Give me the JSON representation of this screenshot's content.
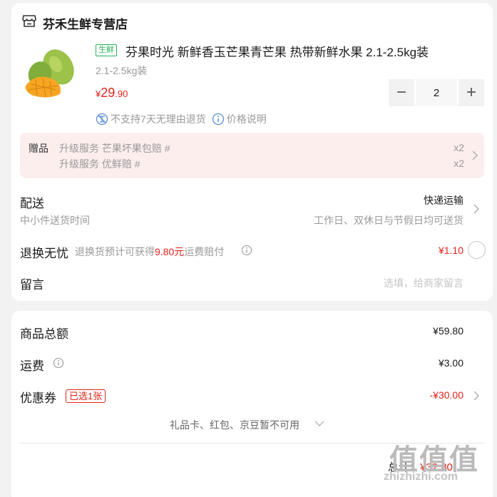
{
  "store": {
    "name": "芬禾生鲜专营店",
    "icon": "store-icon"
  },
  "product": {
    "tag": "生鲜",
    "title": "芬果时光 新鲜香玉芒果青芒果 热带新鲜水果 2.1-2.5kg装",
    "spec": "2.1-2.5kg装",
    "price_symbol": "¥",
    "price_int": "29",
    "price_dec": ".90",
    "quantity": "2",
    "minus": "−",
    "plus": "+",
    "no_return": "不支持7天无理由退货",
    "price_note": "价格说明"
  },
  "gift": {
    "label": "赠品",
    "items": [
      {
        "name": "升级服务 芒果坏果包赔 #",
        "qty": "x2"
      },
      {
        "name": "升级服务 优鲜赔 #",
        "qty": "x2"
      }
    ]
  },
  "delivery": {
    "label": "配送",
    "method": "快递运输",
    "sub_left": "中小件送货时间",
    "sub_right": "工作日、双休日与节假日均可送货"
  },
  "return_worry": {
    "label": "退换无忧",
    "desc_prefix": "退换货预计可获得",
    "desc_amount": "9.80元",
    "desc_suffix": "运费赔付",
    "price": "¥1.10"
  },
  "message": {
    "label": "留言",
    "placeholder": "选填，给商家留言"
  },
  "summary": {
    "goods_label": "商品总额",
    "goods_value": "¥59.80",
    "shipping_label": "运费",
    "shipping_value": "¥3.00",
    "coupon_label": "优惠券",
    "coupon_badge": "已选1张",
    "coupon_value": "-¥30.00",
    "unavailable": "礼品卡、红包、京豆暂不可用",
    "total_label": "总计：",
    "total_value": "¥32.80"
  },
  "watermark": {
    "main": "值值值",
    "sub": "zhizhizhi.com"
  },
  "colors": {
    "accent": "#e2231a",
    "fresh": "#2bb45a",
    "gift_bg": "#fdeeee"
  }
}
